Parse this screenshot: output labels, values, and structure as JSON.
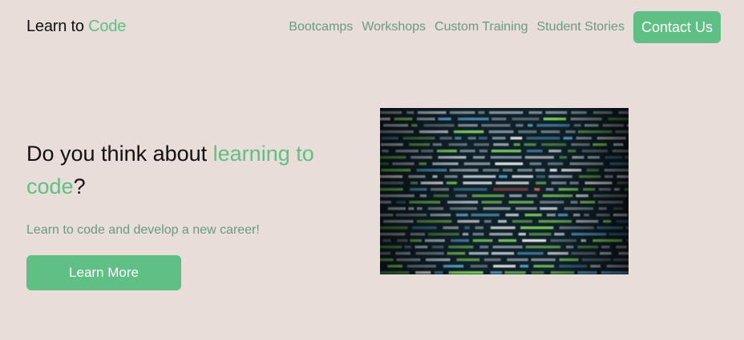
{
  "header": {
    "logo_prefix": "Learn to ",
    "logo_accent": "Code",
    "nav": [
      "Bootcamps",
      "Workshops",
      "Custom Training",
      "Student Stories"
    ],
    "contact_label": "Contact Us"
  },
  "hero": {
    "title_prefix": "Do you think about ",
    "title_accent": "learning to code",
    "title_suffix": "?",
    "subtitle": "Learn to code and develop a new career!",
    "cta_label": "Learn More"
  },
  "image": {
    "icon": "code-screen-photo"
  },
  "colors": {
    "background": "#e8ddd8",
    "accent": "#5fbf84",
    "muted_text": "#6a9a80",
    "dark_text": "#111111"
  }
}
